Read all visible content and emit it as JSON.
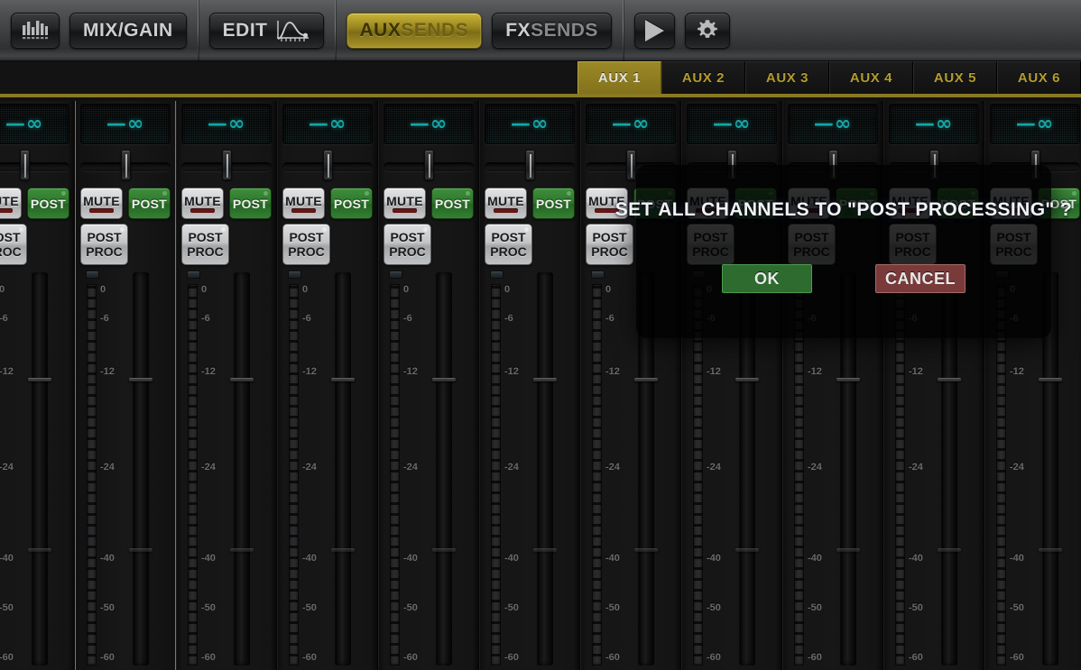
{
  "toolbar": {
    "groups": [
      {
        "buttons": [
          {
            "name": "meters-button",
            "icon": "meter-bars-icon",
            "label": ""
          },
          {
            "name": "mix-gain-button",
            "label": "MIX/GAIN"
          }
        ]
      },
      {
        "buttons": [
          {
            "name": "edit-button",
            "label": "EDIT",
            "icon": "eq-curve-icon"
          }
        ]
      },
      {
        "buttons": [
          {
            "name": "auxsends-button",
            "label1": "AUX",
            "label2": "SENDS",
            "active": true
          },
          {
            "name": "fxsends-button",
            "label1": "FX",
            "label2": "SENDS",
            "active": false
          }
        ]
      },
      {
        "buttons": [
          {
            "name": "play-button",
            "icon": "play-icon",
            "label": ""
          },
          {
            "name": "settings-button",
            "icon": "gear-icon",
            "label": ""
          }
        ]
      }
    ]
  },
  "tabs": {
    "items": [
      {
        "label": "AUX 1",
        "selected": true
      },
      {
        "label": "AUX 2",
        "selected": false
      },
      {
        "label": "AUX 3",
        "selected": false
      },
      {
        "label": "AUX 4",
        "selected": false
      },
      {
        "label": "AUX 5",
        "selected": false
      },
      {
        "label": "AUX 6",
        "selected": false
      }
    ]
  },
  "channels": {
    "labels": {
      "mute": "MUTE",
      "post": "POST",
      "post_proc_line1": "POST",
      "post_proc_line2": "PROC"
    },
    "meter_ticks": [
      "0",
      "-6",
      "-12",
      "-24",
      "-40",
      "-50",
      "-60"
    ],
    "strips": [
      {
        "level": "—∞",
        "selected": false,
        "mute": false,
        "post": true
      },
      {
        "level": "—∞",
        "selected": true,
        "mute": false,
        "post": true
      },
      {
        "level": "—∞",
        "selected": false,
        "mute": false,
        "post": true
      },
      {
        "level": "—∞",
        "selected": false,
        "mute": false,
        "post": true
      },
      {
        "level": "—∞",
        "selected": false,
        "mute": false,
        "post": true
      },
      {
        "level": "—∞",
        "selected": false,
        "mute": false,
        "post": true
      },
      {
        "level": "—∞",
        "selected": false,
        "mute": false,
        "post": true
      },
      {
        "level": "—∞",
        "selected": false,
        "mute": false,
        "post": true
      },
      {
        "level": "—∞",
        "selected": false,
        "mute": false,
        "post": true
      },
      {
        "level": "—∞",
        "selected": false,
        "mute": false,
        "post": true
      },
      {
        "level": "—∞",
        "selected": false,
        "mute": false,
        "post": true
      }
    ]
  },
  "modal": {
    "title": "SET ALL CHANNELS TO \"POST PROCESSING\" ?",
    "ok_label": "OK",
    "cancel_label": "CANCEL",
    "ok_color": "#2d6b2e",
    "cancel_color": "#7a3a3a"
  },
  "colors": {
    "accent_gold": "#8a7a22",
    "lcd_cyan": "#17a5a5",
    "post_green": "#2f7a2e",
    "mute_red": "#7e1d1d"
  }
}
